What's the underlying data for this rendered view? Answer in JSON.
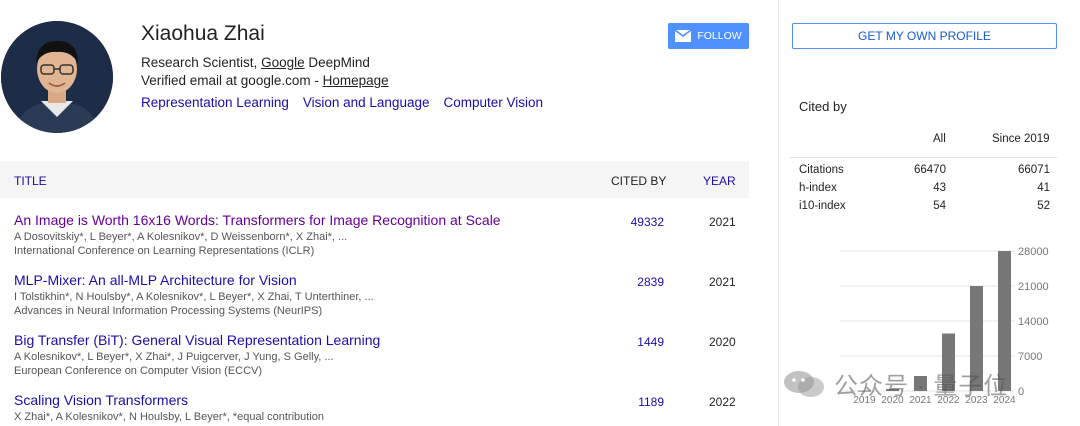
{
  "profile": {
    "name": "Xiaohua Zhai",
    "affiliation_prefix": "Research Scientist, ",
    "affiliation_link": "Google",
    "affiliation_suffix": " DeepMind",
    "email_prefix": "Verified email at google.com - ",
    "homepage": "Homepage",
    "interests": [
      "Representation Learning",
      "Vision and Language",
      "Computer Vision"
    ],
    "follow_label": "FOLLOW"
  },
  "table": {
    "headers": {
      "title": "TITLE",
      "cited_by": "CITED BY",
      "year": "YEAR"
    },
    "rows": [
      {
        "title": "An Image is Worth 16x16 Words: Transformers for Image Recognition at Scale",
        "authors": "A Dosovitskiy*, L Beyer*, A Kolesnikov*, D Weissenborn*, X Zhai*, ...",
        "venue": "International Conference on Learning Representations (ICLR)",
        "cited": "49332",
        "year": "2021"
      },
      {
        "title": "MLP-Mixer: An all-MLP Architecture for Vision",
        "authors": "I Tolstikhin*, N Houlsby*, A Kolesnikov*, L Beyer*, X Zhai, T Unterthiner, ...",
        "venue": "Advances in Neural Information Processing Systems (NeurIPS)",
        "cited": "2839",
        "year": "2021"
      },
      {
        "title": "Big Transfer (BiT): General Visual Representation Learning",
        "authors": "A Kolesnikov*, L Beyer*, X Zhai*, J Puigcerver, J Yung, S Gelly, ...",
        "venue": "European Conference on Computer Vision (ECCV)",
        "cited": "1449",
        "year": "2020"
      },
      {
        "title": "Scaling Vision Transformers",
        "authors": "X Zhai*, A Kolesnikov*, N Houlsby, L Beyer*, *equal contribution",
        "venue": "",
        "cited": "1189",
        "year": "2022"
      }
    ]
  },
  "sidebar": {
    "profile_button": "GET MY OWN PROFILE",
    "cited_by_title": "Cited by",
    "col_all": "All",
    "col_since": "Since 2019",
    "stats": [
      {
        "label": "Citations",
        "all": "66470",
        "since": "66071"
      },
      {
        "label": "h-index",
        "all": "43",
        "since": "41"
      },
      {
        "label": "i10-index",
        "all": "54",
        "since": "52"
      }
    ]
  },
  "watermark": {
    "text": "公众号 · 量子位"
  },
  "colors": {
    "link": "#1a0dab",
    "visited": "#660099",
    "button": "#4d90fe",
    "bar": "#777777"
  },
  "chart_data": {
    "type": "bar",
    "categories": [
      "2019",
      "2020",
      "2021",
      "2022",
      "2023",
      "2024"
    ],
    "values": [
      80,
      400,
      3000,
      11500,
      21000,
      28000
    ],
    "yticks": [
      "28000",
      "21000",
      "14000",
      "7000",
      "0"
    ],
    "ylim": [
      0,
      28000
    ],
    "grid": true
  }
}
